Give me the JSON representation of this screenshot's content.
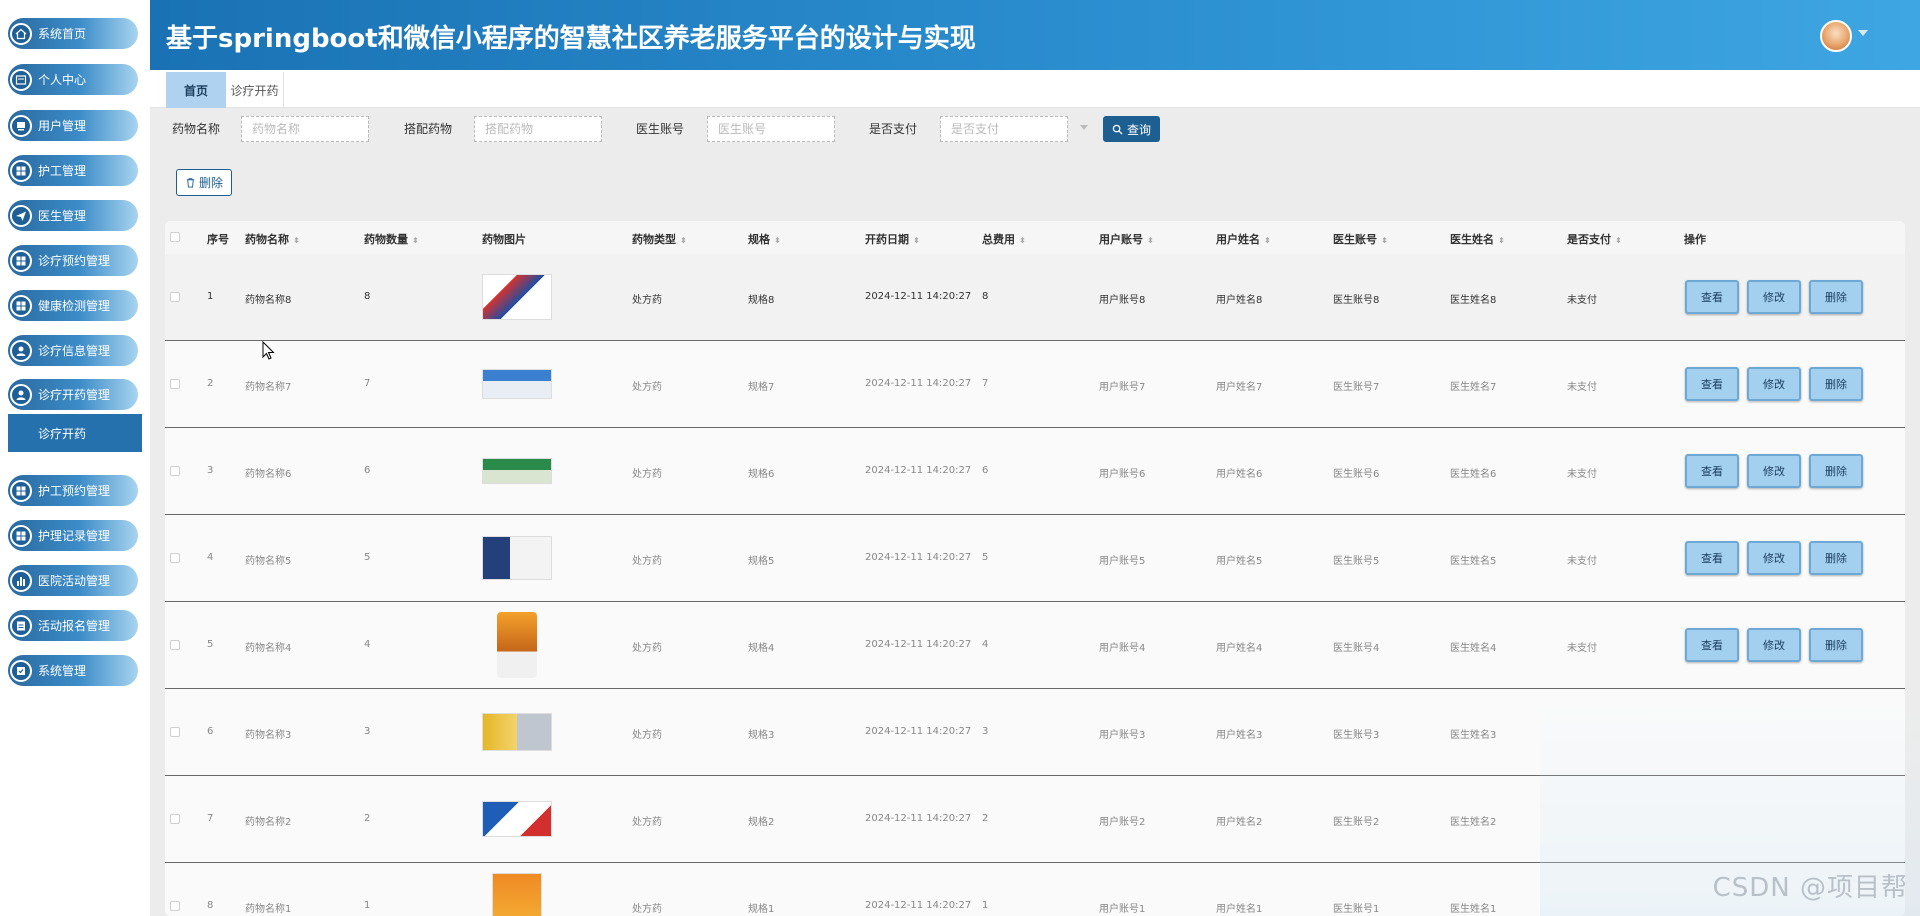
{
  "header": {
    "title": "基于springboot和微信小程序的智慧社区养老服务平台的设计与实现"
  },
  "sidebar": {
    "items": [
      {
        "label": "系统首页",
        "icon": "home-icon"
      },
      {
        "label": "个人中心",
        "icon": "user-card-icon"
      },
      {
        "label": "用户管理",
        "icon": "users-icon"
      },
      {
        "label": "护工管理",
        "icon": "grid-icon"
      },
      {
        "label": "医生管理",
        "icon": "send-icon"
      },
      {
        "label": "诊疗预约管理",
        "icon": "grid-icon"
      },
      {
        "label": "健康检测管理",
        "icon": "grid-icon"
      },
      {
        "label": "诊疗信息管理",
        "icon": "person-icon"
      },
      {
        "label": "诊疗开药管理",
        "icon": "person-icon"
      },
      {
        "label": "护工预约管理",
        "icon": "grid-icon"
      },
      {
        "label": "护理记录管理",
        "icon": "grid-icon"
      },
      {
        "label": "医院活动管理",
        "icon": "bar-chart-icon"
      },
      {
        "label": "活动报名管理",
        "icon": "doc-icon"
      },
      {
        "label": "系统管理",
        "icon": "settings-icon"
      }
    ],
    "submenu": {
      "label": "诊疗开药"
    }
  },
  "tabs": [
    {
      "label": "首页",
      "active": true
    },
    {
      "label": "诊疗开药",
      "active": false
    }
  ],
  "filters": [
    {
      "label": "药物名称",
      "placeholder": "药物名称"
    },
    {
      "label": "搭配药物",
      "placeholder": "搭配药物"
    },
    {
      "label": "医生账号",
      "placeholder": "医生账号"
    },
    {
      "label": "是否支付",
      "placeholder": "是否支付"
    }
  ],
  "buttons": {
    "search": "查询",
    "delete": "删除",
    "view": "查看",
    "edit": "修改",
    "remove": "删除"
  },
  "table": {
    "columns": [
      "序号",
      "药物名称",
      "药物数量",
      "药物图片",
      "药物类型",
      "规格",
      "开药日期",
      "总费用",
      "用户账号",
      "用户姓名",
      "医生账号",
      "医生姓名",
      "是否支付",
      "操作"
    ],
    "rows": [
      {
        "no": "1",
        "name": "药物名称8",
        "qty": "8",
        "type": "处方药",
        "spec": "规格8",
        "date": "2024-12-11 14:20:27",
        "fee": "8",
        "user_acc": "用户账号8",
        "user_name": "用户姓名8",
        "doc_acc": "医生账号8",
        "doc_name": "医生姓名8",
        "paid": "未支付",
        "img": "red-white-box"
      },
      {
        "no": "2",
        "name": "药物名称7",
        "qty": "7",
        "type": "处方药",
        "spec": "规格7",
        "date": "2024-12-11 14:20:27",
        "fee": "7",
        "user_acc": "用户账号7",
        "user_name": "用户姓名7",
        "doc_acc": "医生账号7",
        "doc_name": "医生姓名7",
        "paid": "未支付",
        "img": "blue-capsule-box"
      },
      {
        "no": "3",
        "name": "药物名称6",
        "qty": "6",
        "type": "处方药",
        "spec": "规格6",
        "date": "2024-12-11 14:20:27",
        "fee": "6",
        "user_acc": "用户账号6",
        "user_name": "用户姓名6",
        "doc_acc": "医生账号6",
        "doc_name": "医生姓名6",
        "paid": "未支付",
        "img": "green-box"
      },
      {
        "no": "4",
        "name": "药物名称5",
        "qty": "5",
        "type": "处方药",
        "spec": "规格5",
        "date": "2024-12-11 14:20:27",
        "fee": "5",
        "user_acc": "用户账号5",
        "user_name": "用户姓名5",
        "doc_acc": "医生账号5",
        "doc_name": "医生姓名5",
        "paid": "未支付",
        "img": "navy-white-box"
      },
      {
        "no": "5",
        "name": "药物名称4",
        "qty": "4",
        "type": "处方药",
        "spec": "规格4",
        "date": "2024-12-11 14:20:27",
        "fee": "4",
        "user_acc": "用户账号4",
        "user_name": "用户姓名4",
        "doc_acc": "医生账号4",
        "doc_name": "医生姓名4",
        "paid": "未支付",
        "img": "amber-bottle"
      },
      {
        "no": "6",
        "name": "药物名称3",
        "qty": "3",
        "type": "处方药",
        "spec": "规格3",
        "date": "2024-12-11 14:20:27",
        "fee": "3",
        "user_acc": "用户账号3",
        "user_name": "用户姓名3",
        "doc_acc": "医生账号3",
        "doc_name": "医生姓名3",
        "paid": "",
        "img": "yellow-blister"
      },
      {
        "no": "7",
        "name": "药物名称2",
        "qty": "2",
        "type": "处方药",
        "spec": "规格2",
        "date": "2024-12-11 14:20:27",
        "fee": "2",
        "user_acc": "用户账号2",
        "user_name": "用户姓名2",
        "doc_acc": "医生账号2",
        "doc_name": "医生姓名2",
        "paid": "",
        "img": "blue-red-box"
      },
      {
        "no": "8",
        "name": "药物名称1",
        "qty": "1",
        "type": "处方药",
        "spec": "规格1",
        "date": "2024-12-11 14:20:27",
        "fee": "1",
        "user_acc": "用户账号1",
        "user_name": "用户姓名1",
        "doc_acc": "医生账号1",
        "doc_name": "医生姓名1",
        "paid": "",
        "img": "orange-box"
      }
    ]
  },
  "watermark": "CSDN @项目帮",
  "colors": {
    "header": "#2388c8",
    "sidebar_pill": "#3c8cc8",
    "button_dark": "#1d5f91",
    "action_button": "#a2d0ee"
  }
}
